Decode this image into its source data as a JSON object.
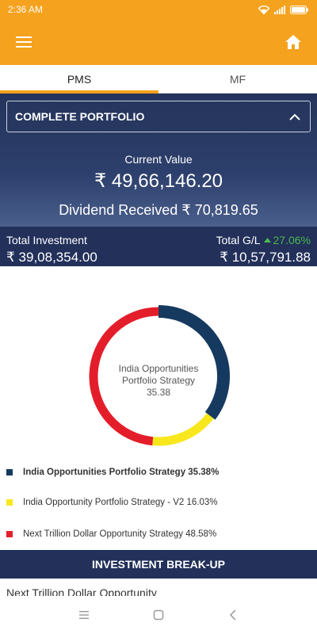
{
  "status_bar": {
    "time": "2:36 AM",
    "icons": [
      "wifi-icon",
      "signal-icon",
      "battery-icon"
    ]
  },
  "app_bar": {
    "left_icon": "menu-icon",
    "right_icon": "home-icon",
    "background": "#f5a21e"
  },
  "tabs": [
    {
      "label": "PMS",
      "active": true
    },
    {
      "label": "MF",
      "active": false
    }
  ],
  "portfolio_selector": {
    "value": "COMPLETE PORTFOLIO",
    "icon": "chevron-up-icon"
  },
  "summary": {
    "current_value_label": "Current Value",
    "current_value": "₹ 49,66,146.20",
    "dividend_text": "Dividend Received ₹ 70,819.65"
  },
  "totals": {
    "investment_label": "Total Investment",
    "investment_value": "₹ 39,08,354.00",
    "gl_label": "Total G/L",
    "gl_percent": "27.06%",
    "gl_value": "₹ 10,57,791.88",
    "gl_color": "#4cb84f"
  },
  "chart_data": {
    "type": "pie",
    "donut": true,
    "center_label": [
      "India Opportunities",
      "Portfolio Strategy",
      "35.38"
    ],
    "slices": [
      {
        "label": "India Opportunities Portfolio Strategy",
        "value": 35.38,
        "color": "#163a5f"
      },
      {
        "label": "India Opportunity Portfolio Strategy - V2",
        "value": 16.03,
        "color": "#f8e71c"
      },
      {
        "label": "Next Trillion Dollar Opportunity Strategy",
        "value": 48.58,
        "color": "#e31e2a"
      }
    ]
  },
  "legend": [
    {
      "text": "India Opportunities Portfolio Strategy 35.38%",
      "color": "#163a5f",
      "bold": true
    },
    {
      "text": "India Opportunity Portfolio Strategy - V2 16.03%",
      "color": "#f8e71c",
      "bold": false
    },
    {
      "text": "Next Trillion Dollar Opportunity Strategy 48.58%",
      "color": "#e31e2a",
      "bold": false
    }
  ],
  "breakup": {
    "header": "INVESTMENT BREAK-UP",
    "first_row": "Next Trillion Dollar Opportunity"
  },
  "nav_bar": {
    "icons": [
      "recents-icon",
      "home-square-icon",
      "back-icon"
    ]
  }
}
